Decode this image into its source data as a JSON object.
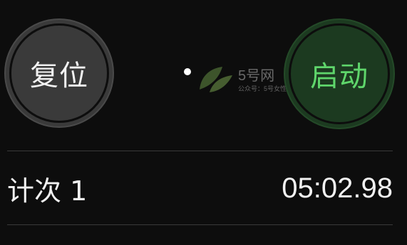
{
  "controls": {
    "reset_label": "复位",
    "start_label": "启动"
  },
  "pager": {
    "count": 2,
    "active_index": 0
  },
  "watermark": {
    "title": "5号网",
    "subtitle": "公众号：5号女性"
  },
  "laps": [
    {
      "label": "计次 1",
      "time": "05:02.98"
    }
  ],
  "colors": {
    "background": "#0d0d0d",
    "reset_button": "#3a3a3a",
    "start_button": "#1c3a20",
    "start_text": "#5fd66b",
    "divider": "#3a3a3a"
  }
}
